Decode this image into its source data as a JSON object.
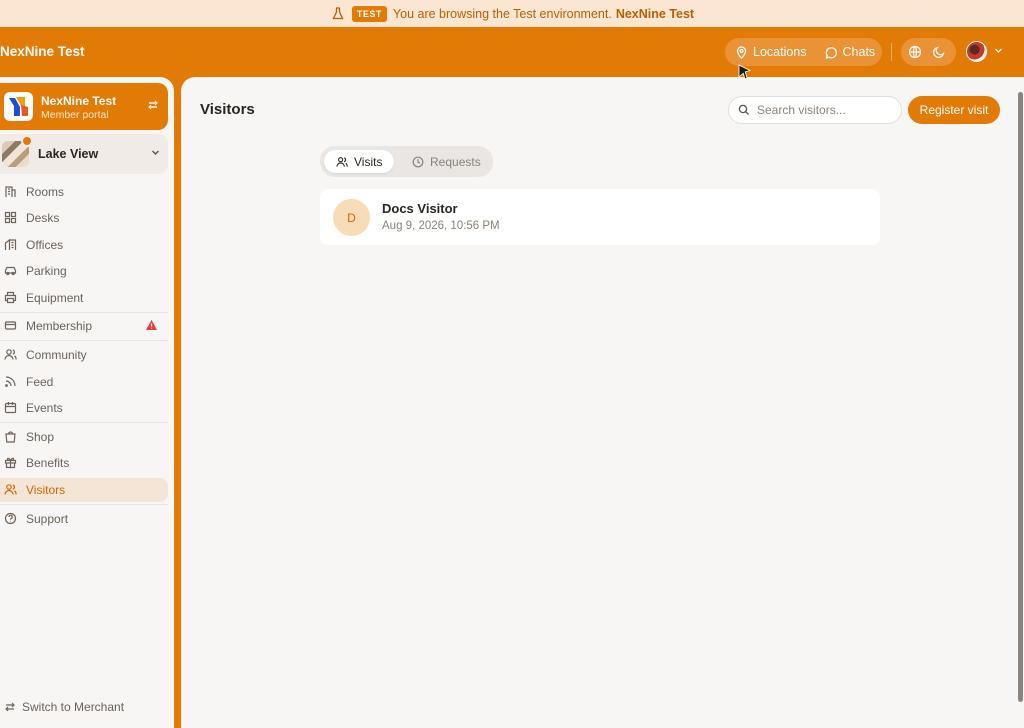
{
  "banner": {
    "badge": "TEST",
    "message": "You are browsing the Test environment.",
    "brand": "NexNine Test"
  },
  "header": {
    "brand": "NexNine Test",
    "nav": [
      {
        "label": "Locations",
        "icon": "map-pin-icon"
      },
      {
        "label": "Chats",
        "icon": "chat-bubble-icon"
      }
    ],
    "tools": [
      "globe-icon",
      "moon-icon"
    ]
  },
  "sidebar": {
    "portal": {
      "title": "NexNine Test",
      "subtitle": "Member portal"
    },
    "location": {
      "name": "Lake View"
    },
    "items": [
      {
        "label": "Rooms",
        "icon": "building-icon"
      },
      {
        "label": "Desks",
        "icon": "grid-icon"
      },
      {
        "label": "Offices",
        "icon": "office-icon"
      },
      {
        "label": "Parking",
        "icon": "car-icon"
      },
      {
        "label": "Equipment",
        "icon": "printer-icon"
      },
      {
        "label": "Membership",
        "icon": "card-icon",
        "alert": true
      },
      {
        "label": "Community",
        "icon": "users-icon"
      },
      {
        "label": "Feed",
        "icon": "rss-icon"
      },
      {
        "label": "Events",
        "icon": "calendar-icon"
      },
      {
        "label": "Shop",
        "icon": "shopping-bag-icon"
      },
      {
        "label": "Benefits",
        "icon": "gift-icon"
      },
      {
        "label": "Visitors",
        "icon": "users-icon",
        "active": true
      },
      {
        "label": "Support",
        "icon": "help-circle-icon"
      }
    ],
    "footer": {
      "label": "Switch to Merchant"
    }
  },
  "main": {
    "title": "Visitors",
    "search": {
      "placeholder": "Search visitors...",
      "value": ""
    },
    "register_label": "Register visit",
    "tabs": [
      {
        "label": "Visits",
        "active": true
      },
      {
        "label": "Requests",
        "active": false
      }
    ],
    "visits": [
      {
        "initial": "D",
        "name": "Docs Visitor",
        "date": "Aug 9, 2026, 10:56 PM"
      }
    ]
  },
  "colors": {
    "accent": "#e27a06",
    "banner_bg": "#fbe6d1",
    "surface": "#f7f6f5",
    "alert": "#e53935"
  }
}
